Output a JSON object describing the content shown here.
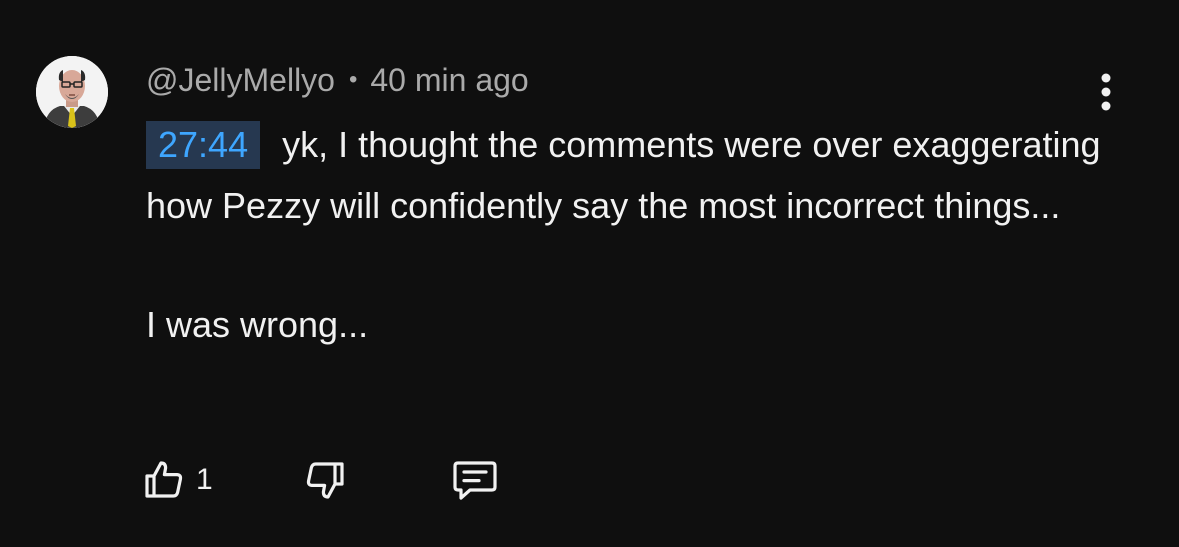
{
  "comment": {
    "author": "@JellyMellyo",
    "separator": "•",
    "time_ago": "40 min ago",
    "timestamp_link": "27:44",
    "text_line1": "yk, I thought the comments were over exaggerating how Pezzy will confidently say the most incorrect things...",
    "text_line2": "I was wrong...",
    "like_count": "1"
  },
  "icons": {
    "avatar": "avatar-cartoon-man",
    "like": "thumbs-up-icon",
    "dislike": "thumbs-down-icon",
    "reply": "reply-comment-icon",
    "menu": "more-vertical-icon"
  },
  "colors": {
    "background": "#0f0f0f",
    "text": "#f1f1f1",
    "secondary_text": "#aaaaaa",
    "timestamp_link": "#3ea6ff",
    "timestamp_bg": "#263850"
  }
}
